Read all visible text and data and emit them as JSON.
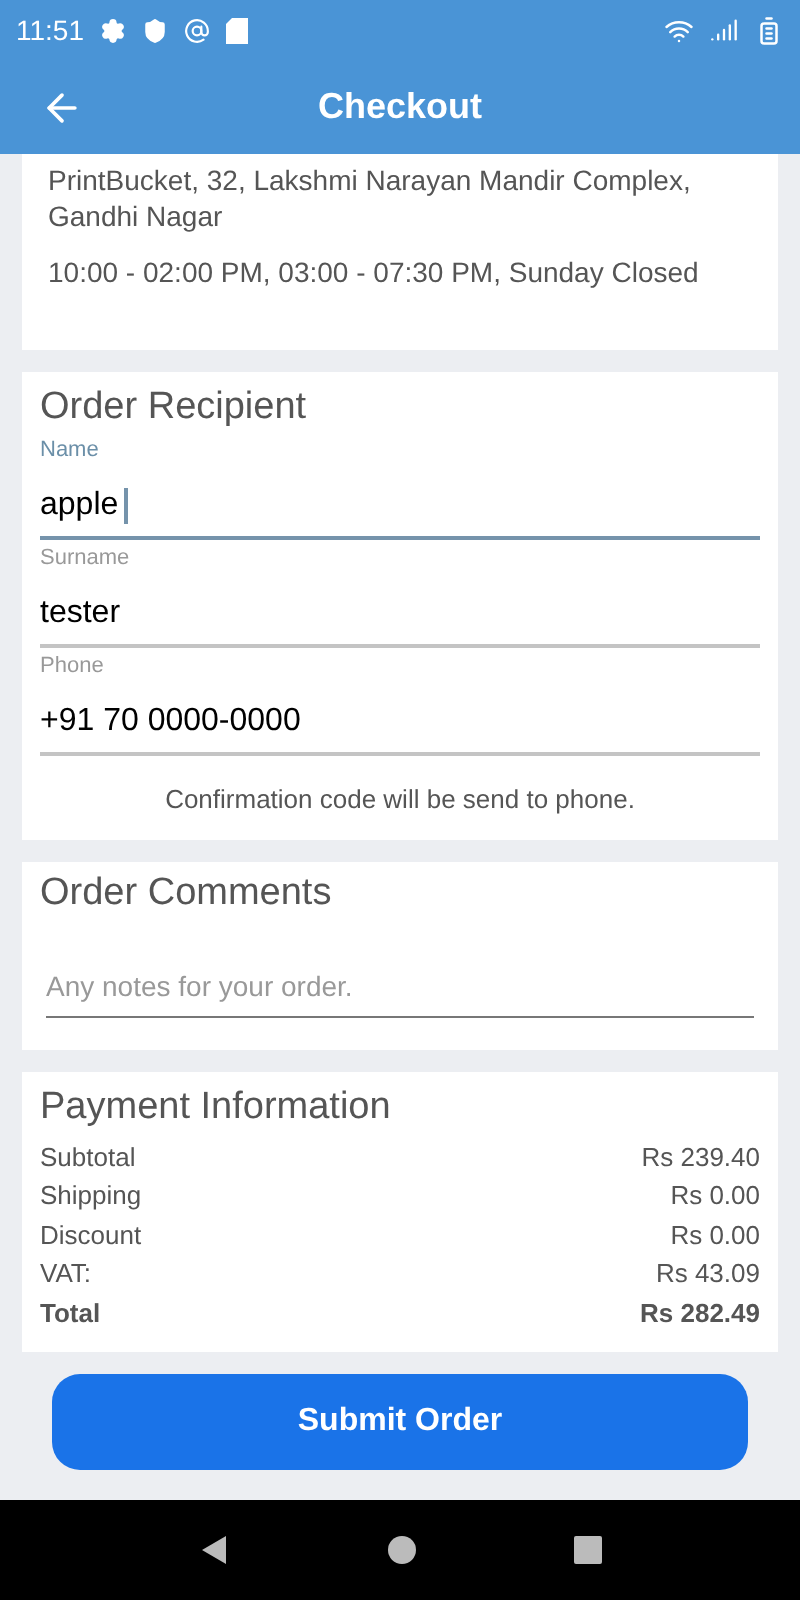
{
  "status_bar": {
    "time": "11:51"
  },
  "app_bar": {
    "title": "Checkout"
  },
  "store": {
    "address": "PrintBucket, 32, Lakshmi Narayan Mandir Complex, Gandhi Nagar",
    "hours": "10:00 - 02:00 PM, 03:00 - 07:30 PM, Sunday Closed"
  },
  "recipient": {
    "title": "Order Recipient",
    "fields": [
      {
        "label": "Name",
        "value": "apple",
        "focused": true
      },
      {
        "label": "Surname",
        "value": "tester",
        "focused": false
      },
      {
        "label": "Phone",
        "value": "+91 70 0000-0000",
        "focused": false
      }
    ],
    "note": "Confirmation code will be send to phone."
  },
  "comments": {
    "title": "Order Comments",
    "placeholder": "Any notes for your order."
  },
  "payment": {
    "title": "Payment Information",
    "rows": [
      {
        "label": "Subtotal",
        "value": "Rs 239.40",
        "kind": "line"
      },
      {
        "label": "Shipping",
        "value": "Rs 0.00",
        "kind": "line"
      },
      {
        "label": "Discount",
        "value": "Rs 0.00",
        "kind": "line"
      },
      {
        "label": "VAT:",
        "value": "Rs 43.09",
        "kind": "line"
      },
      {
        "label": "Total",
        "value": "Rs 282.49",
        "kind": "total"
      }
    ]
  },
  "submit": {
    "label": "Submit Order"
  }
}
